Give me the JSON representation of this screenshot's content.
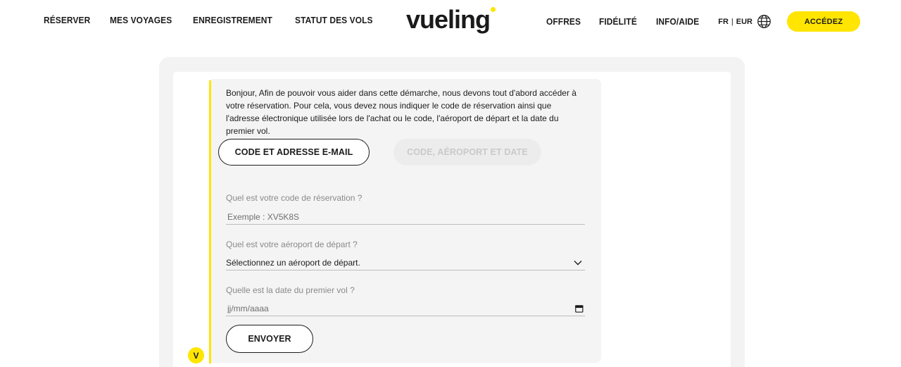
{
  "nav": {
    "left": [
      "RÉSERVER",
      "MES VOYAGES",
      "ENREGISTREMENT",
      "STATUT DES VOLS"
    ],
    "right": [
      "OFFRES",
      "FIDÉLITÉ",
      "INFO/AIDE"
    ],
    "language": "FR",
    "currency": "EUR",
    "cta": "ACCÉDEZ"
  },
  "logo": {
    "text": "vueling",
    "accent_color": "#ffe500"
  },
  "chat": {
    "intro": "Bonjour, Afin de pouvoir vous aider dans cette démarche, nous devons tout d'abord accéder à votre réservation. Pour cela, vous devez nous indiquer le code de réservation ainsi que l'adresse électronique utilisée lors de l'achat ou le code, l'aéroport de départ et la date du premier vol.",
    "tabs": {
      "active": "CODE ET ADRESSE E-MAIL",
      "inactive": "CODE, AÉROPORT ET DATE"
    },
    "fields": {
      "code_label": "Quel est votre code de réservation ?",
      "code_placeholder": "Exemple : XV5K8S",
      "airport_label": "Quel est votre aéroport de départ ?",
      "airport_value": "Sélectionnez un aéroport de départ.",
      "date_label": "Quelle est la date du premier vol ?",
      "date_placeholder": "jj/mm/aaaa"
    },
    "submit": "ENVOYER",
    "avatar_letter": "V"
  },
  "icons": [
    "globe-icon",
    "chevron-down-icon",
    "calendar-icon"
  ]
}
